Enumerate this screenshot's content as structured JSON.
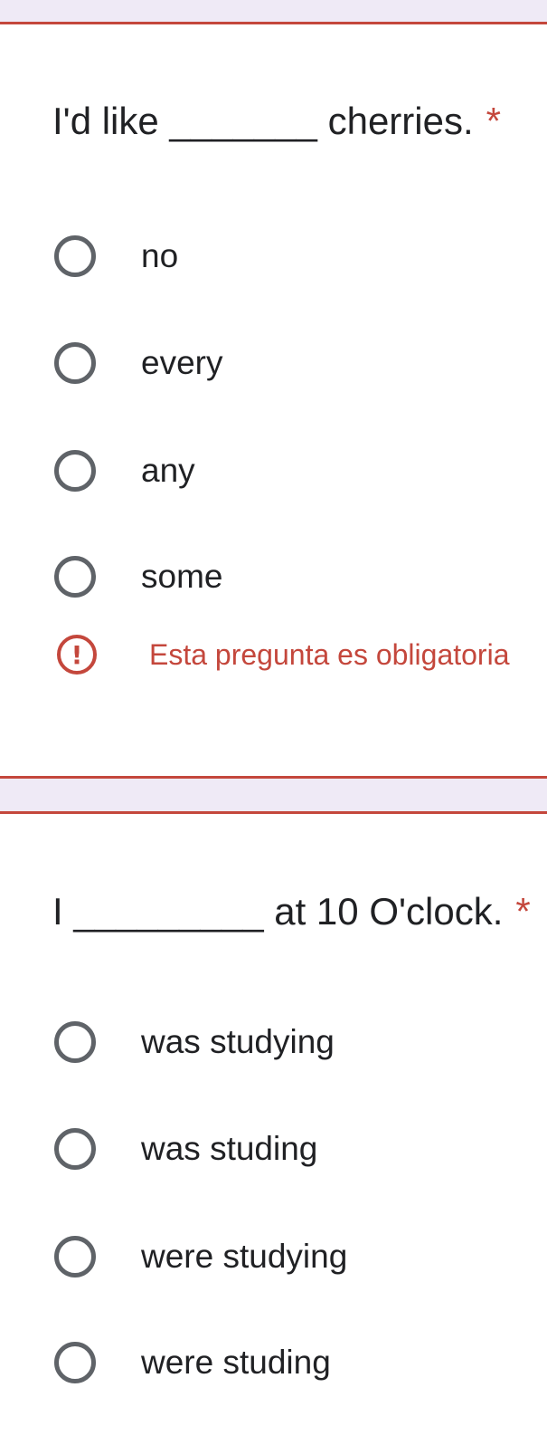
{
  "questions": [
    {
      "text": "I'd like _______ cherries.",
      "required_mark": "*",
      "options": [
        "no",
        "every",
        "any",
        "some"
      ],
      "error": {
        "icon": "exclamation-circle-icon",
        "text": "Esta pregunta es obligatoria"
      }
    },
    {
      "text": "I _________ at 10 O'clock.",
      "required_mark": "*",
      "options": [
        "was studying",
        "was studing",
        "were studying",
        "were studing"
      ]
    }
  ],
  "colors": {
    "background": "#efeaf6",
    "card": "#ffffff",
    "error_red": "#c4473c",
    "radio_gray": "#5f6368",
    "text": "#202124"
  }
}
